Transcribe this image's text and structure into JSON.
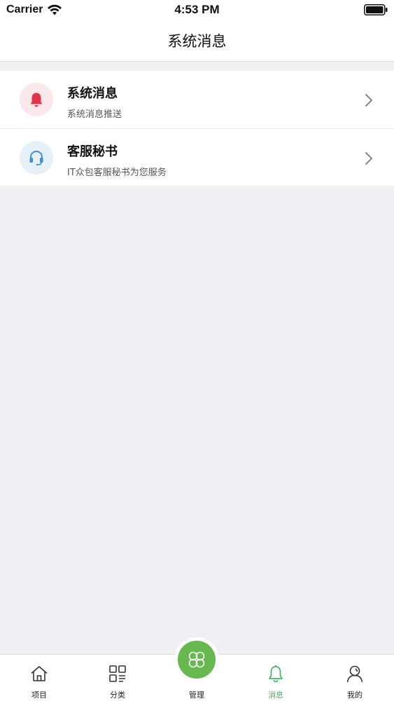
{
  "status_bar": {
    "carrier": "Carrier",
    "time": "4:53 PM"
  },
  "nav": {
    "title": "系统消息"
  },
  "messages": [
    {
      "title": "系统消息",
      "subtitle": "系统消息推送",
      "icon": "bell-icon",
      "icon_color": "#e0364a",
      "icon_bg": "#fbe8ea"
    },
    {
      "title": "客服秘书",
      "subtitle": "IT众包客服秘书为您服务",
      "icon": "headset-icon",
      "icon_color": "#3a8fd8",
      "icon_bg": "#e5f0f8"
    }
  ],
  "tabs": [
    {
      "label": "项目",
      "icon": "home-icon",
      "active": false
    },
    {
      "label": "分类",
      "icon": "category-grid-icon",
      "active": false
    },
    {
      "label": "管理",
      "icon": "clover-icon",
      "active": false
    },
    {
      "label": "消息",
      "icon": "bell-outline-icon",
      "active": true
    },
    {
      "label": "我的",
      "icon": "user-icon",
      "active": false
    }
  ],
  "colors": {
    "accent": "#4cb062",
    "center_button": "#66b84f",
    "background": "#efeff4"
  }
}
